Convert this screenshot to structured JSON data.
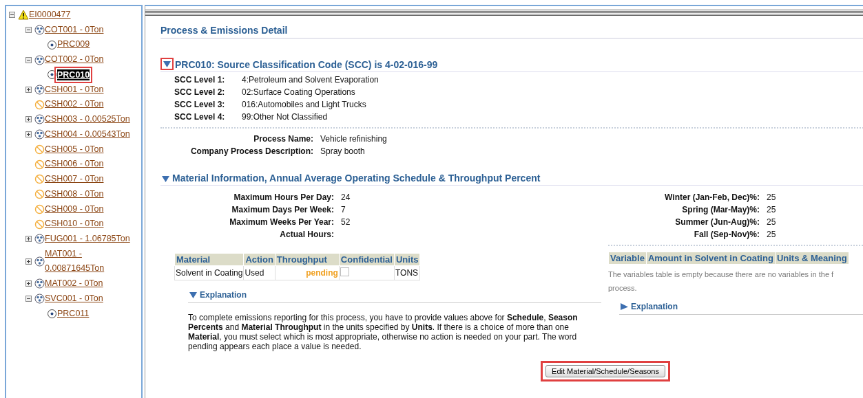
{
  "tree": {
    "label": "EI0000477",
    "kind": "warning",
    "expanded": true,
    "selected": false,
    "children": [
      {
        "label": "COT001 - 0Ton",
        "kind": "emission",
        "expanded": true,
        "selected": false,
        "children": [
          {
            "label": "PRC009",
            "kind": "process",
            "selected": false
          }
        ]
      },
      {
        "label": "COT002 - 0Ton",
        "kind": "emission",
        "expanded": true,
        "selected": false,
        "children": [
          {
            "label": "PRC010",
            "kind": "process",
            "selected": true,
            "annotated": true
          }
        ]
      },
      {
        "label": "CSH001 - 0Ton",
        "kind": "emission",
        "expanded": false,
        "selected": false
      },
      {
        "label": "CSH002 - 0Ton",
        "kind": "prohibited",
        "selected": false
      },
      {
        "label": "CSH003 - 0.00525Ton",
        "kind": "emission",
        "expanded": false,
        "selected": false
      },
      {
        "label": "CSH004 - 0.00543Ton",
        "kind": "emission",
        "expanded": false,
        "selected": false
      },
      {
        "label": "CSH005 - 0Ton",
        "kind": "prohibited",
        "selected": false
      },
      {
        "label": "CSH006 - 0Ton",
        "kind": "prohibited",
        "selected": false
      },
      {
        "label": "CSH007 - 0Ton",
        "kind": "prohibited",
        "selected": false
      },
      {
        "label": "CSH008 - 0Ton",
        "kind": "prohibited",
        "selected": false
      },
      {
        "label": "CSH009 - 0Ton",
        "kind": "prohibited",
        "selected": false
      },
      {
        "label": "CSH010 - 0Ton",
        "kind": "prohibited",
        "selected": false
      },
      {
        "label": "FUG001 - 1.06785Ton",
        "kind": "emission",
        "expanded": false,
        "selected": false
      },
      {
        "label": "MAT001 - 0.00871645Ton",
        "kind": "emission",
        "expanded": false,
        "selected": false
      },
      {
        "label": "MAT002 - 0Ton",
        "kind": "emission",
        "expanded": false,
        "selected": false
      },
      {
        "label": "SVC001 - 0Ton",
        "kind": "emission",
        "expanded": true,
        "selected": false,
        "children": [
          {
            "label": "PRC011",
            "kind": "process",
            "selected": false
          }
        ]
      }
    ]
  },
  "detail": {
    "title": "Process & Emissions Detail",
    "scc_section": {
      "heading": "PRC010: Source Classification Code (SCC) is 4-02-016-99",
      "expanded": true,
      "annotated": true,
      "levels": [
        {
          "label": "SCC Level 1:",
          "value": "4:Petroleum and Solvent Evaporation"
        },
        {
          "label": "SCC Level 2:",
          "value": "02:Surface Coating Operations"
        },
        {
          "label": "SCC Level 3:",
          "value": "016:Automobiles and Light Trucks"
        },
        {
          "label": "SCC Level 4:",
          "value": "99:Other Not Classified"
        }
      ],
      "process": [
        {
          "label": "Process Name:",
          "value": "Vehicle refinishing"
        },
        {
          "label": "Company Process Description:",
          "value": "Spray booth"
        }
      ]
    },
    "material_section": {
      "heading": "Material Information, Annual Average Operating Schedule & Throughput Percent",
      "expanded": true,
      "schedule": [
        {
          "label": "Maximum Hours Per Day:",
          "value": "24"
        },
        {
          "label": "Maximum Days Per Week:",
          "value": "7"
        },
        {
          "label": "Maximum Weeks Per Year:",
          "value": "52"
        },
        {
          "label": "Actual Hours:"
        }
      ],
      "seasons": [
        {
          "label": "Winter (Jan-Feb, Dec)%:",
          "value": "25"
        },
        {
          "label": "Spring (Mar-May)%:",
          "value": "25"
        },
        {
          "label": "Summer (Jun-Aug)%:",
          "value": "25"
        },
        {
          "label": "Fall (Sep-Nov)%:",
          "value": "25"
        }
      ],
      "material_table": {
        "columns": [
          "Material",
          "Action",
          "Throughput",
          "Confidential",
          "Units"
        ],
        "rows": [
          {
            "material": "Solvent in Coating",
            "action": "Used",
            "throughput": "pending",
            "confidential": false,
            "units": "TONS"
          }
        ]
      },
      "variables_table": {
        "columns": [
          "Variable",
          "Amount in Solvent in Coating",
          "Units & Meaning"
        ],
        "empty_lines": [
          "The variables table is empty because there are no variables in the f",
          "process."
        ]
      },
      "explanation_left": {
        "label": "Explanation",
        "expanded": true,
        "text": "To complete emissions reporting for this process, you have to provide values above for **Schedule**, **Season Percents** and **Material Throughput** in the units specified by **Units**. If there is a choice of more than one **Material**, you must select which is most appropriate, otherwise no action is needed on your part. The word pending appears each place a value is needed."
      },
      "explanation_right": {
        "label": "Explanation",
        "expanded": false
      },
      "edit_button": {
        "label": "Edit Material/Schedule/Seasons",
        "annotated": true
      }
    }
  }
}
